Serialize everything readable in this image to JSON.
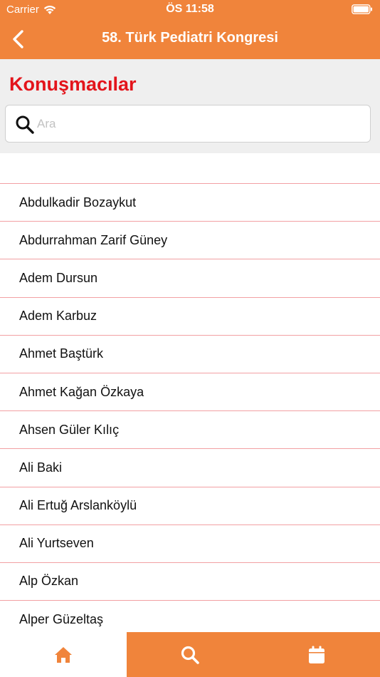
{
  "status_bar": {
    "carrier": "Carrier",
    "time": "ÖS 11:58",
    "icons": [
      "wifi-icon",
      "battery-icon"
    ]
  },
  "nav": {
    "title": "58. Türk Pediatri Kongresi",
    "back_icon": "chevron-left-icon"
  },
  "page": {
    "title": "Konuşmacılar"
  },
  "search": {
    "placeholder": "Ara",
    "value": "",
    "icon": "search-icon"
  },
  "speakers": [
    "Abdulkadir Bozaykut",
    "Abdurrahman Zarif Güney",
    "Adem Dursun",
    "Adem Karbuz",
    "Ahmet Baştürk",
    "Ahmet Kağan Özkaya",
    "Ahsen Güler Kılıç",
    "Ali Baki",
    "Ali Ertuğ Arslanköylü",
    "Ali Yurtseven",
    "Alp Özkan",
    "Alper Güzeltaş"
  ],
  "tabs": [
    {
      "icon": "home-icon",
      "active": false
    },
    {
      "icon": "search-icon",
      "active": true
    },
    {
      "icon": "calendar-icon",
      "active": true
    }
  ],
  "colors": {
    "accent": "#f0843b",
    "title_red": "#e3141b",
    "divider": "#f2a0a3",
    "header_bg": "#efefef"
  }
}
